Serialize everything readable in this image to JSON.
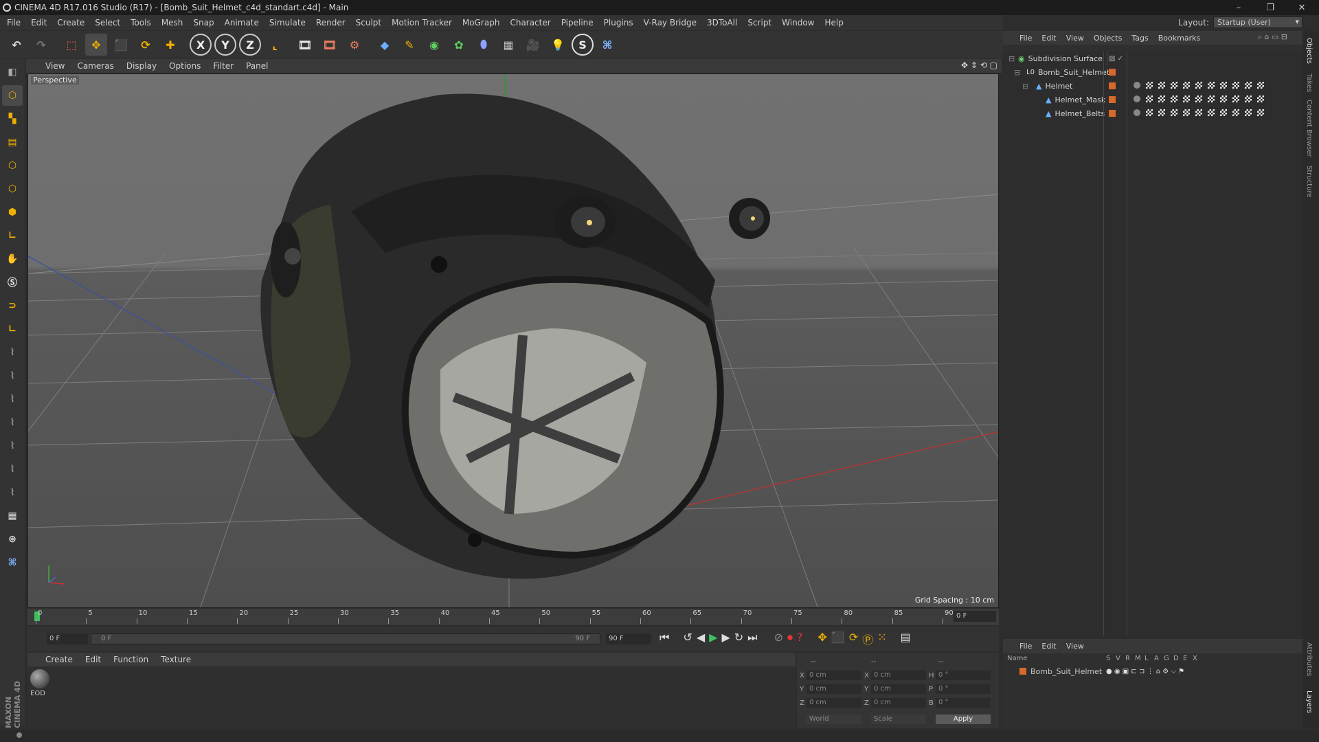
{
  "window": {
    "title": "CINEMA 4D R17.016 Studio (R17) - [Bomb_Suit_Helmet_c4d_standart.c4d] - Main",
    "controls": [
      "–",
      "❐",
      "✕"
    ]
  },
  "menubar": {
    "items": [
      "File",
      "Edit",
      "Create",
      "Select",
      "Tools",
      "Mesh",
      "Snap",
      "Animate",
      "Simulate",
      "Render",
      "Sculpt",
      "Motion Tracker",
      "MoGraph",
      "Character",
      "Pipeline",
      "Plugins",
      "V-Ray Bridge",
      "3DToAll",
      "Script",
      "Window",
      "Help"
    ],
    "layout_label": "Layout:",
    "layout_value": "Startup (User)"
  },
  "toolbar": {
    "icons": [
      "undo-icon",
      "redo-icon",
      "live-selection-icon",
      "move-icon",
      "scale-icon",
      "rotate-icon",
      "plus-icon",
      "x-axis-icon",
      "y-axis-icon",
      "z-axis-icon",
      "coordinate-system-icon",
      "render-view-icon",
      "render-picture-viewer-icon",
      "edit-render-settings-icon",
      "cube-icon",
      "pen-spline-icon",
      "nurbs-icon",
      "array-icon",
      "deformer-icon",
      "floor-icon",
      "camera-icon",
      "light-icon",
      "vray-icon",
      "python-icon"
    ],
    "axis_labels": [
      "X",
      "Y",
      "Z"
    ]
  },
  "lefttools": {
    "icons": [
      "make-editable-icon",
      "model-mode-icon",
      "texture-mode-icon",
      "workplane-mode-icon",
      "points-mode-icon",
      "edges-mode-icon",
      "polygons-mode-icon",
      "axis-mode-icon",
      "tweak-icon",
      "solo-icon",
      "magnet-icon",
      "snap-icon",
      "brush-icon",
      "sculpt-icon",
      "knife-icon",
      "extrude-icon",
      "bevel-icon",
      "bridge-icon",
      "loop-cut-icon",
      "grid-lock-icon",
      "paint-icon",
      "python-icon"
    ]
  },
  "viewport": {
    "menu": [
      "View",
      "Cameras",
      "Display",
      "Options",
      "Filter",
      "Panel"
    ],
    "label": "Perspective",
    "grid_spacing": "Grid Spacing : 10 cm"
  },
  "timeline": {
    "ticks": [
      "0",
      "5",
      "10",
      "15",
      "20",
      "25",
      "30",
      "35",
      "40",
      "45",
      "50",
      "55",
      "60",
      "65",
      "70",
      "75",
      "80",
      "85",
      "90"
    ],
    "current_frame": "0 F",
    "start_field": "0 F",
    "range_start": "0 F",
    "range_end": "90 F",
    "end_field": "90 F"
  },
  "material_manager": {
    "menu": [
      "Create",
      "Edit",
      "Function",
      "Texture"
    ],
    "materials": [
      {
        "name": "EOD"
      }
    ]
  },
  "coordinates": {
    "headers": [
      "--",
      "--",
      "--"
    ],
    "rows": [
      {
        "axis": "X",
        "pos": "0 cm",
        "size_axis": "X",
        "size": "0 cm",
        "rot_axis": "H",
        "rot": "0 °"
      },
      {
        "axis": "Y",
        "pos": "0 cm",
        "size_axis": "Y",
        "size": "0 cm",
        "rot_axis": "P",
        "rot": "0 °"
      },
      {
        "axis": "Z",
        "pos": "0 cm",
        "size_axis": "Z",
        "size": "0 cm",
        "rot_axis": "B",
        "rot": "0 °"
      }
    ],
    "world": "World",
    "scale": "Scale",
    "apply": "Apply"
  },
  "object_manager": {
    "menu": [
      "File",
      "Edit",
      "View",
      "Objects",
      "Tags",
      "Bookmarks"
    ],
    "objects": [
      {
        "name": "Subdivision Surface",
        "indent": 0
      },
      {
        "name": "Bomb_Suit_Helmet",
        "indent": 1
      },
      {
        "name": "Helmet",
        "indent": 2
      },
      {
        "name": "Helmet_Mask",
        "indent": 3
      },
      {
        "name": "Helmet_Belts",
        "indent": 3
      }
    ]
  },
  "layer_manager": {
    "menu": [
      "File",
      "Edit",
      "View"
    ],
    "columns": [
      "Name",
      "S",
      "V",
      "R",
      "M",
      "L",
      "A",
      "G",
      "D",
      "E",
      "X"
    ],
    "layers": [
      {
        "name": "Bomb_Suit_Helmet",
        "color": "#d8692a"
      }
    ]
  },
  "side_tabs": [
    "Objects",
    "Takes",
    "Content Browser",
    "Structure",
    "Attributes",
    "Layers"
  ],
  "brand": "MAXON CINEMA 4D",
  "colors": {
    "accent_orange": "#d8692a",
    "accent_blue": "#4a90d9",
    "highlight": "#5a7fa8"
  }
}
